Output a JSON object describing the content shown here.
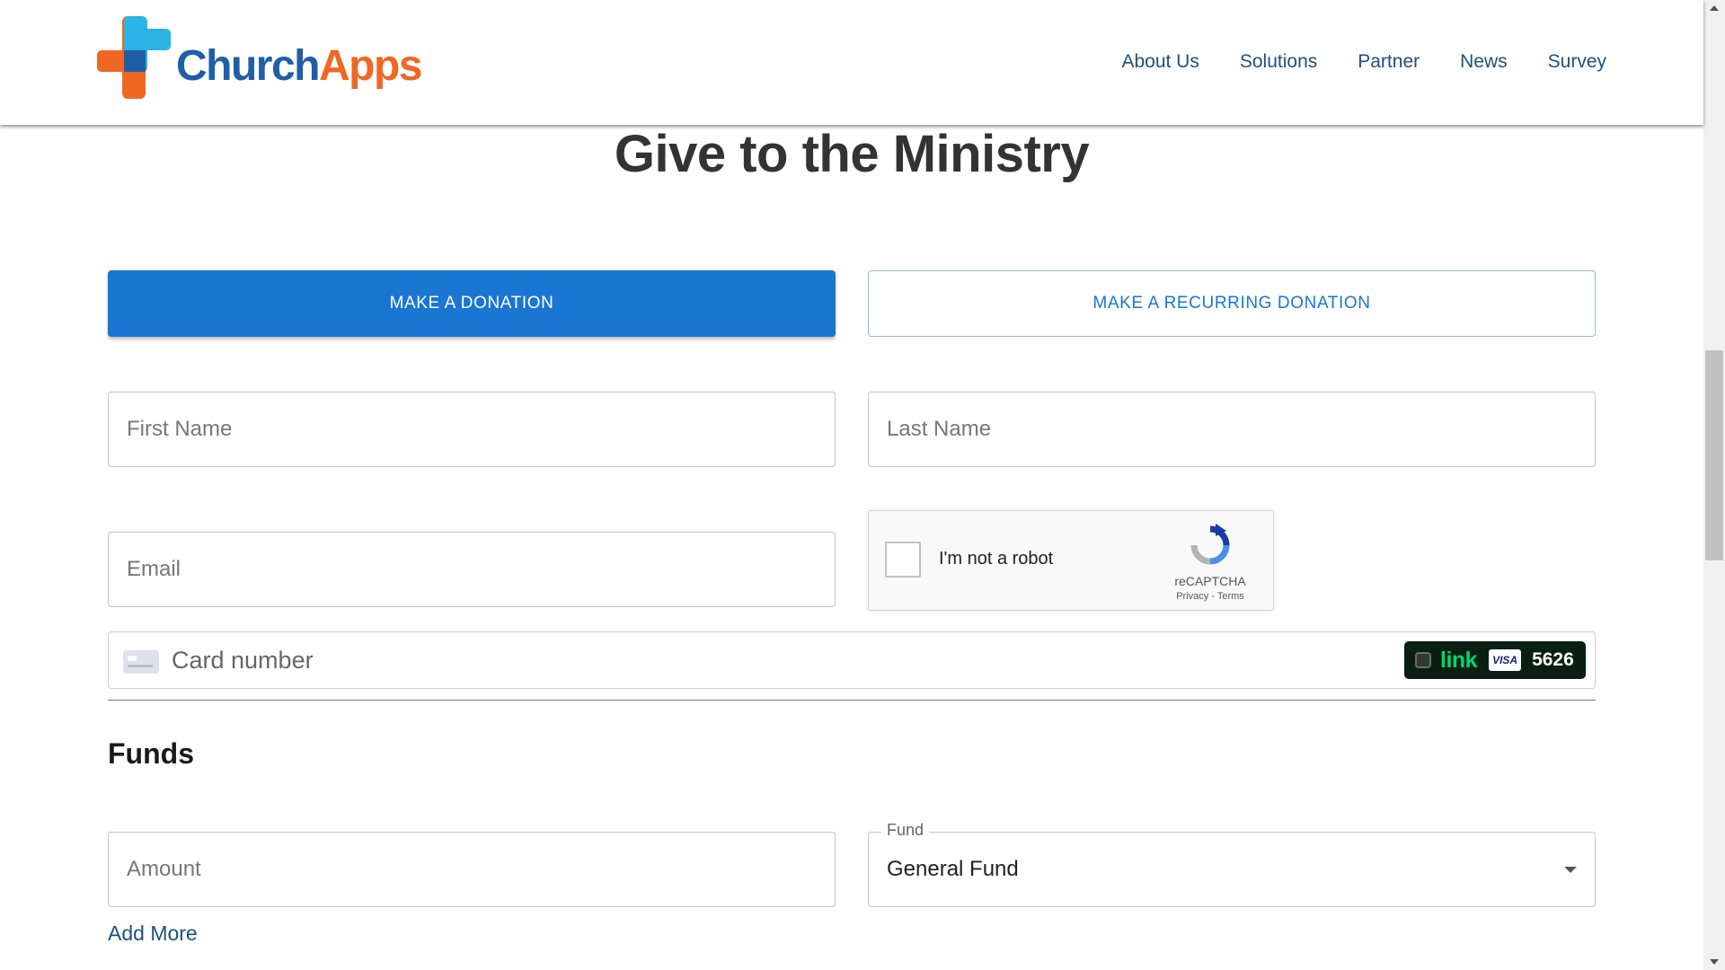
{
  "brand": {
    "name_part1": "Church",
    "name_part2": "Apps"
  },
  "nav": [
    "About Us",
    "Solutions",
    "Partner",
    "News",
    "Survey"
  ],
  "page": {
    "title": "Give to the Ministry"
  },
  "tabs": {
    "donation": "MAKE A DONATION",
    "recurring": "MAKE A RECURRING DONATION"
  },
  "form": {
    "first_name_placeholder": "First Name",
    "last_name_placeholder": "Last Name",
    "email_placeholder": "Email",
    "card_placeholder": "Card number"
  },
  "captcha": {
    "label": "I'm not a robot",
    "brand": "reCAPTCHA",
    "links": "Privacy - Terms"
  },
  "link_badge": {
    "word": "link",
    "card_brand": "VISA",
    "last4": "5626"
  },
  "funds": {
    "heading": "Funds",
    "amount_placeholder": "Amount",
    "fund_label": "Fund",
    "fund_value": "General Fund",
    "add_more": "Add More"
  },
  "colors": {
    "primary": "#1976d2",
    "brand_blue": "#1f5fa8",
    "brand_orange": "#f06724",
    "link_green": "#00d66f"
  }
}
